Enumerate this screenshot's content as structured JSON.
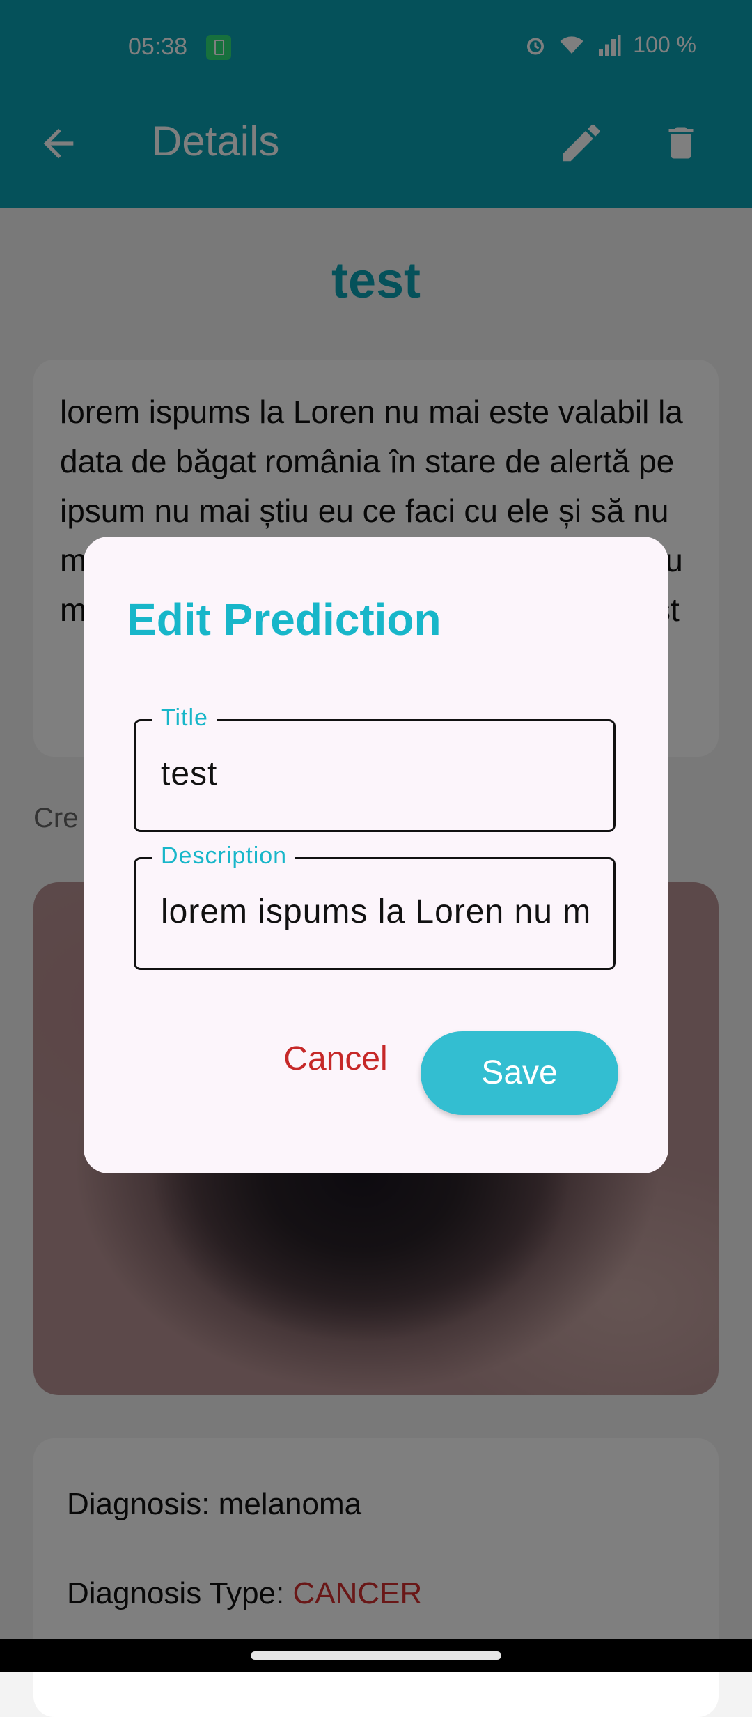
{
  "status_bar": {
    "time": "05:38",
    "battery": "100 %"
  },
  "app_bar": {
    "title": "Details",
    "icons": [
      "back-arrow",
      "edit-pencil",
      "delete-trash"
    ]
  },
  "prediction": {
    "title": "test",
    "description": "lorem ispums la Loren nu mai este valabil la data de băgat românia în stare de alertă pe ipsum nu mai știu eu ce faci cu ele și să nu mai încerci să faci ceva în plus pentru că nu mai este nevoie de asta pentru că nu mai st",
    "created_label": "Cre",
    "diagnosis_label": "Diagnosis: ",
    "diagnosis_value": "melanoma",
    "diagnosis_type_label": "Diagnosis Type: ",
    "diagnosis_type_value": "CANCER"
  },
  "dialog": {
    "title": "Edit Prediction",
    "title_field": {
      "label": "Title",
      "value": "test"
    },
    "description_field": {
      "label": "Description",
      "value": "lorem ispums la Loren nu m"
    },
    "cancel_label": "Cancel",
    "save_label": "Save"
  },
  "colors": {
    "primary": "#0aa3b4",
    "accent": "#33bed1",
    "danger": "#c62828"
  }
}
